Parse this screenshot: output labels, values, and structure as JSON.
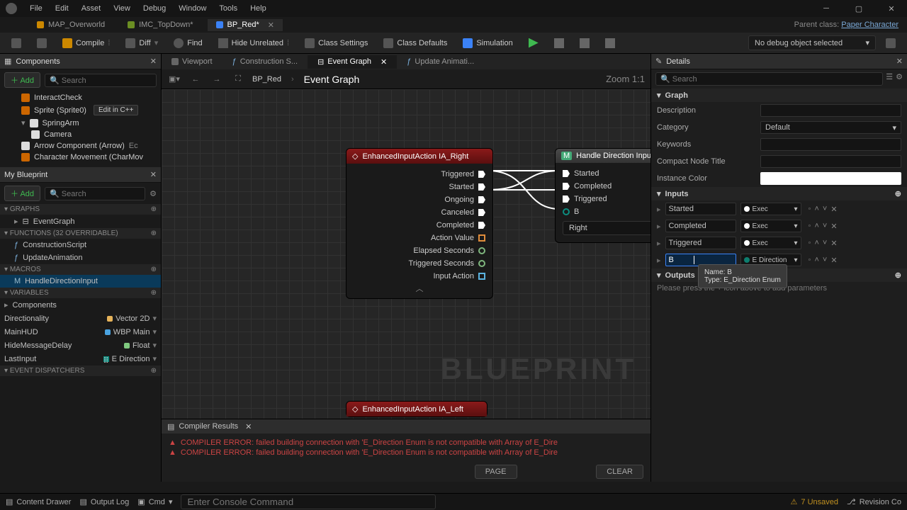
{
  "menubar": {
    "items": [
      "File",
      "Edit",
      "Asset",
      "View",
      "Debug",
      "Window",
      "Tools",
      "Help"
    ]
  },
  "parent_class": {
    "label": "Parent class:",
    "value": "Paper Character"
  },
  "asset_tabs": [
    {
      "label": "MAP_Overworld",
      "icon": "orange"
    },
    {
      "label": "IMC_TopDown*",
      "icon": "green"
    },
    {
      "label": "BP_Red*",
      "icon": "blue",
      "active": true
    }
  ],
  "toolbar": {
    "compile": "Compile",
    "diff": "Diff",
    "find": "Find",
    "hide": "Hide Unrelated",
    "class_settings": "Class Settings",
    "class_defaults": "Class Defaults",
    "simulation": "Simulation",
    "debug_select": "No debug object selected"
  },
  "components": {
    "title": "Components",
    "add": "Add",
    "search": "Search",
    "items": [
      {
        "label": "InteractCheck",
        "lvl": 1,
        "ico": "orange"
      },
      {
        "label": "Sprite (Sprite0)",
        "lvl": 1,
        "ico": "orange",
        "edit_cpp": "Edit in C++"
      },
      {
        "label": "SpringArm",
        "lvl": 1,
        "ico": "white"
      },
      {
        "label": "Camera",
        "lvl": 2,
        "ico": "white"
      },
      {
        "label": "Arrow Component (Arrow)",
        "lvl": 1,
        "ico": "white",
        "suffix": "Ec"
      },
      {
        "label": "Character Movement (CharMov",
        "lvl": 1,
        "ico": "orange"
      }
    ]
  },
  "myblueprint": {
    "title": "My Blueprint",
    "add": "Add",
    "search": "Search",
    "graphs_hdr": "GRAPHS",
    "graphs": [
      "EventGraph"
    ],
    "functions_hdr": "FUNCTIONS (32 OVERRIDABLE)",
    "functions": [
      "ConstructionScript",
      "UpdateAnimation"
    ],
    "macros_hdr": "MACROS",
    "macros": [
      {
        "label": "HandleDirectionInput",
        "active": true
      }
    ],
    "variables_hdr": "VARIABLES",
    "vars": [
      {
        "sub": "Components"
      },
      {
        "name": "Directionality",
        "type": "Vector 2D",
        "color": "#e6b35a"
      },
      {
        "name": "MainHUD",
        "type": "WBP Main",
        "color": "#4aa3e0"
      },
      {
        "name": "HideMessageDelay",
        "type": "Float",
        "color": "#7fc97f"
      },
      {
        "name": "LastInput",
        "type": "E Direction",
        "color": "#0c8d80"
      }
    ],
    "dispatchers_hdr": "EVENT DISPATCHERS"
  },
  "center_tabs": [
    {
      "label": "Viewport"
    },
    {
      "label": "Construction S..."
    },
    {
      "label": "Event Graph",
      "active": true
    },
    {
      "label": "Update Animati..."
    }
  ],
  "breadcrumb": {
    "root": "BP_Red",
    "graph": "Event Graph",
    "zoom": "Zoom 1:1"
  },
  "node1": {
    "title": "EnhancedInputAction IA_Right",
    "pins": [
      "Triggered",
      "Started",
      "Ongoing",
      "Canceled",
      "Completed",
      "Action Value",
      "Elapsed Seconds",
      "Triggered Seconds",
      "Input Action"
    ]
  },
  "node2": {
    "title": "Handle Direction Input",
    "pins": [
      "Started",
      "Completed",
      "Triggered"
    ],
    "param": "B",
    "param_value": "Right"
  },
  "node3": {
    "title": "EnhancedInputAction IA_Left"
  },
  "compiler": {
    "title": "Compiler Results",
    "errors": [
      "COMPILER ERROR: failed building connection with 'E_Direction Enum is not compatible with Array of E_Dire",
      "COMPILER ERROR: failed building connection with 'E_Direction Enum is not compatible with Array of E_Dire"
    ],
    "page": "PAGE",
    "clear": "CLEAR"
  },
  "details": {
    "title": "Details",
    "search": "Search",
    "sections": {
      "graph": "Graph",
      "graph_rows": [
        {
          "label": "Description",
          "kind": "input"
        },
        {
          "label": "Category",
          "kind": "combo",
          "value": "Default"
        },
        {
          "label": "Keywords",
          "kind": "input"
        },
        {
          "label": "Compact Node Title",
          "kind": "input"
        },
        {
          "label": "Instance Color",
          "kind": "swatch"
        }
      ],
      "inputs": "Inputs",
      "input_pins": [
        {
          "name": "Started",
          "type": "Exec",
          "dot": "exec"
        },
        {
          "name": "Completed",
          "type": "Exec",
          "dot": "exec"
        },
        {
          "name": "Triggered",
          "type": "Exec",
          "dot": "exec"
        },
        {
          "name": "B",
          "type": "E Direction",
          "dot": "enum",
          "editing": true
        }
      ],
      "outputs": "Outputs",
      "outputs_hint": "Please press the + icon above to add parameters"
    }
  },
  "tooltip": {
    "line1": "Name: B",
    "line2": "Type: E_Direction Enum"
  },
  "bottom": {
    "content_drawer": "Content Drawer",
    "output_log": "Output Log",
    "cmd_label": "Cmd",
    "cmd_placeholder": "Enter Console Command",
    "unsaved": "7 Unsaved",
    "revision": "Revision Co"
  }
}
